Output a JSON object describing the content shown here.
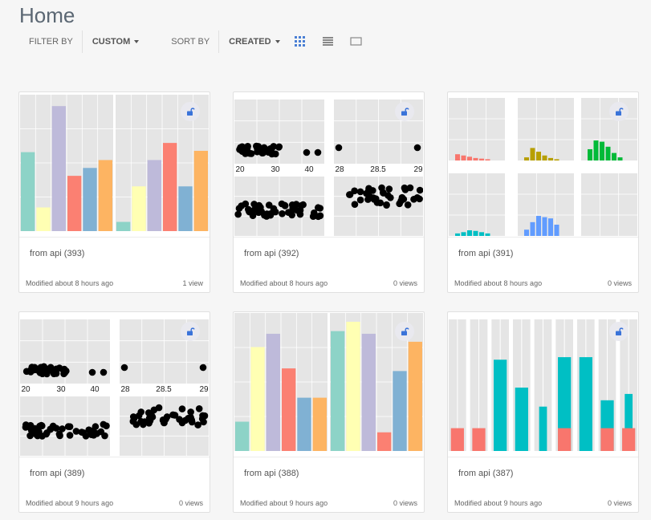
{
  "page": {
    "title": "Home"
  },
  "toolbar": {
    "filter_label": "FILTER BY",
    "filter_value": "CUSTOM",
    "sort_label": "SORT BY",
    "sort_value": "CREATED",
    "view_icons": [
      "grid-view-icon",
      "list-view-icon",
      "single-view-icon"
    ]
  },
  "colors": {
    "accent": "#4a7fd4",
    "pastel": [
      "#8dd3c7",
      "#ffffb3",
      "#bebada",
      "#fb8072",
      "#80b1d3",
      "#fdb462"
    ],
    "facet": [
      "#f8766d",
      "#b79f00",
      "#00ba38",
      "#00bfc4",
      "#619cff",
      "#f564e3"
    ],
    "teal": "#00bfc4",
    "red": "#f8766d"
  },
  "cards": [
    {
      "title": "from api (393)",
      "modified": "Modified about 8 hours ago",
      "views": "1 view",
      "thumb": "bars2"
    },
    {
      "title": "from api (392)",
      "modified": "Modified about 8 hours ago",
      "views": "0 views",
      "thumb": "scatter"
    },
    {
      "title": "from api (391)",
      "modified": "Modified about 8 hours ago",
      "views": "0 views",
      "thumb": "facets"
    },
    {
      "title": "from api (389)",
      "modified": "Modified about 9 hours ago",
      "views": "0 views",
      "thumb": "scatter"
    },
    {
      "title": "from api (388)",
      "modified": "Modified about 9 hours ago",
      "views": "0 views",
      "thumb": "bars2"
    },
    {
      "title": "from api (387)",
      "modified": "Modified about 9 hours ago",
      "views": "0 views",
      "thumb": "strips"
    }
  ],
  "scatter_ticks": {
    "left": [
      "20",
      "30",
      "40"
    ],
    "right": [
      "28",
      "28.5",
      "29"
    ]
  }
}
